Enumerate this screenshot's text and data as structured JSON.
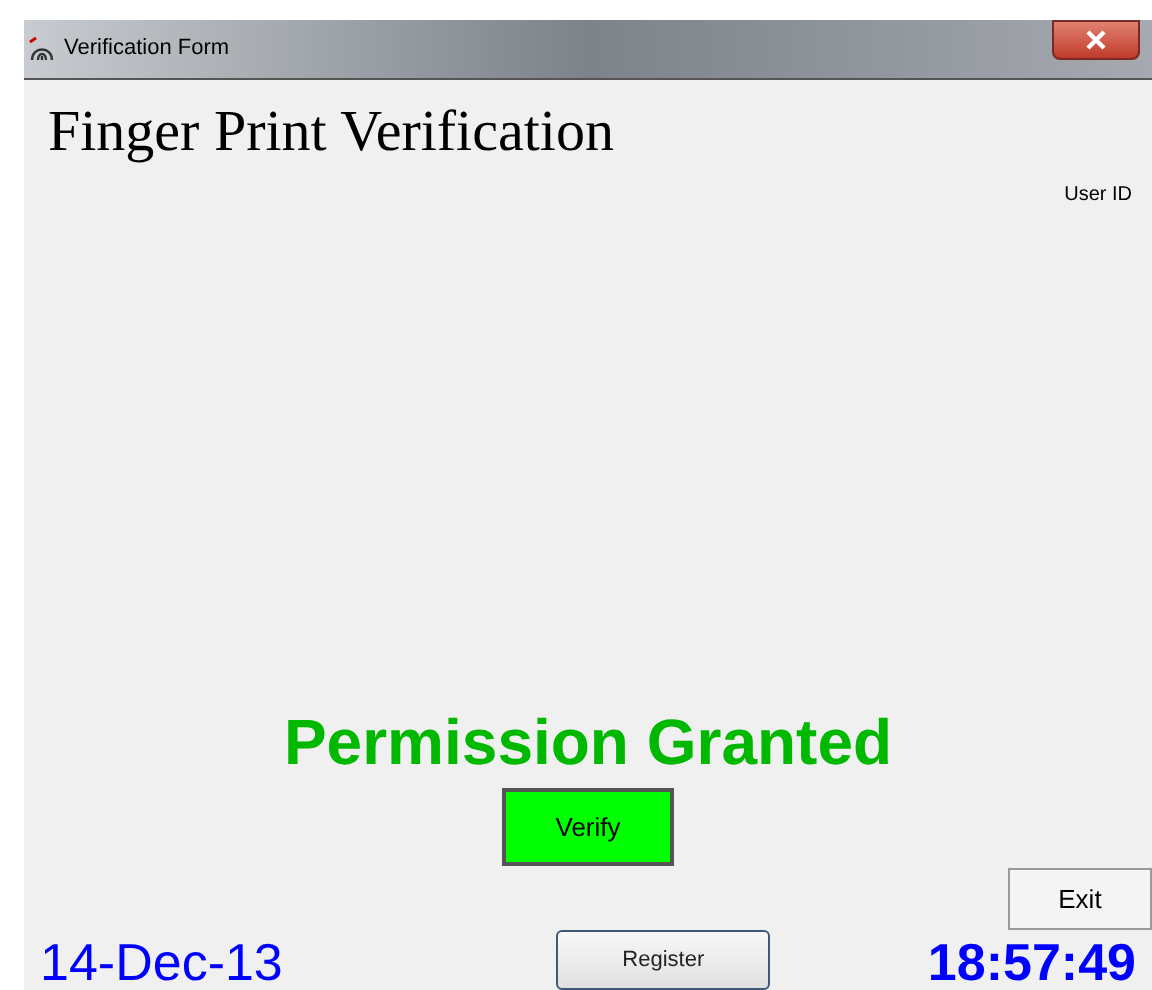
{
  "window": {
    "title": "Verification Form"
  },
  "heading": "Finger Print Verification",
  "user_id_label": "User ID",
  "status": {
    "text": "Permission Granted",
    "granted": true
  },
  "buttons": {
    "verify": "Verify",
    "exit": "Exit",
    "register": "Register"
  },
  "date": "14-Dec-13",
  "time": "18:57:49"
}
